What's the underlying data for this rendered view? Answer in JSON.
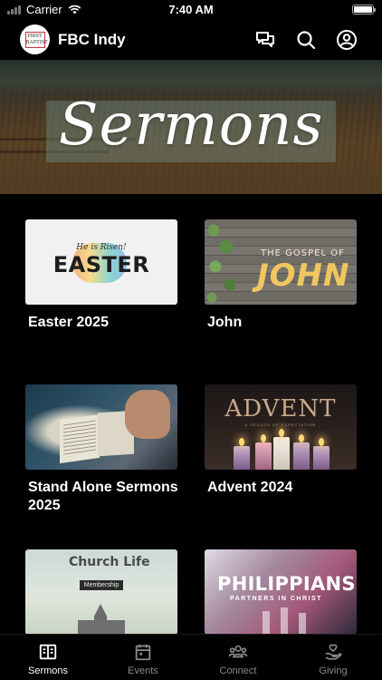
{
  "status_bar": {
    "carrier": "Carrier",
    "time": "7:40 AM"
  },
  "header": {
    "app_title": "FBC Indy",
    "logo_text": "FIRST BAPTIST",
    "icons": [
      "chat-icon",
      "search-icon",
      "profile-icon"
    ]
  },
  "hero": {
    "title": "Sermons"
  },
  "series": [
    {
      "title": "Easter 2025",
      "thumb_text": "EASTER",
      "thumb_subtext": "He is Risen!"
    },
    {
      "title": "John",
      "thumb_text": "JOHN",
      "thumb_subtext": "THE GOSPEL OF"
    },
    {
      "title": "Stand Alone Sermons 2025"
    },
    {
      "title": "Advent 2024",
      "thumb_text": "ADVENT",
      "thumb_subtext": "A SEASON OF EXPECTATION"
    },
    {
      "title": "",
      "thumb_text": "Church Life",
      "thumb_subtext": "Membership"
    },
    {
      "title": "",
      "thumb_text": "PHILIPPIANS",
      "thumb_subtext": "PARTNERS IN CHRIST"
    }
  ],
  "tabs": [
    {
      "label": "Sermons",
      "active": true
    },
    {
      "label": "Events",
      "active": false
    },
    {
      "label": "Connect",
      "active": false
    },
    {
      "label": "Giving",
      "active": false
    }
  ],
  "colors": {
    "background": "#000000",
    "text": "#ffffff",
    "tab_inactive": "#8a8a8a"
  }
}
